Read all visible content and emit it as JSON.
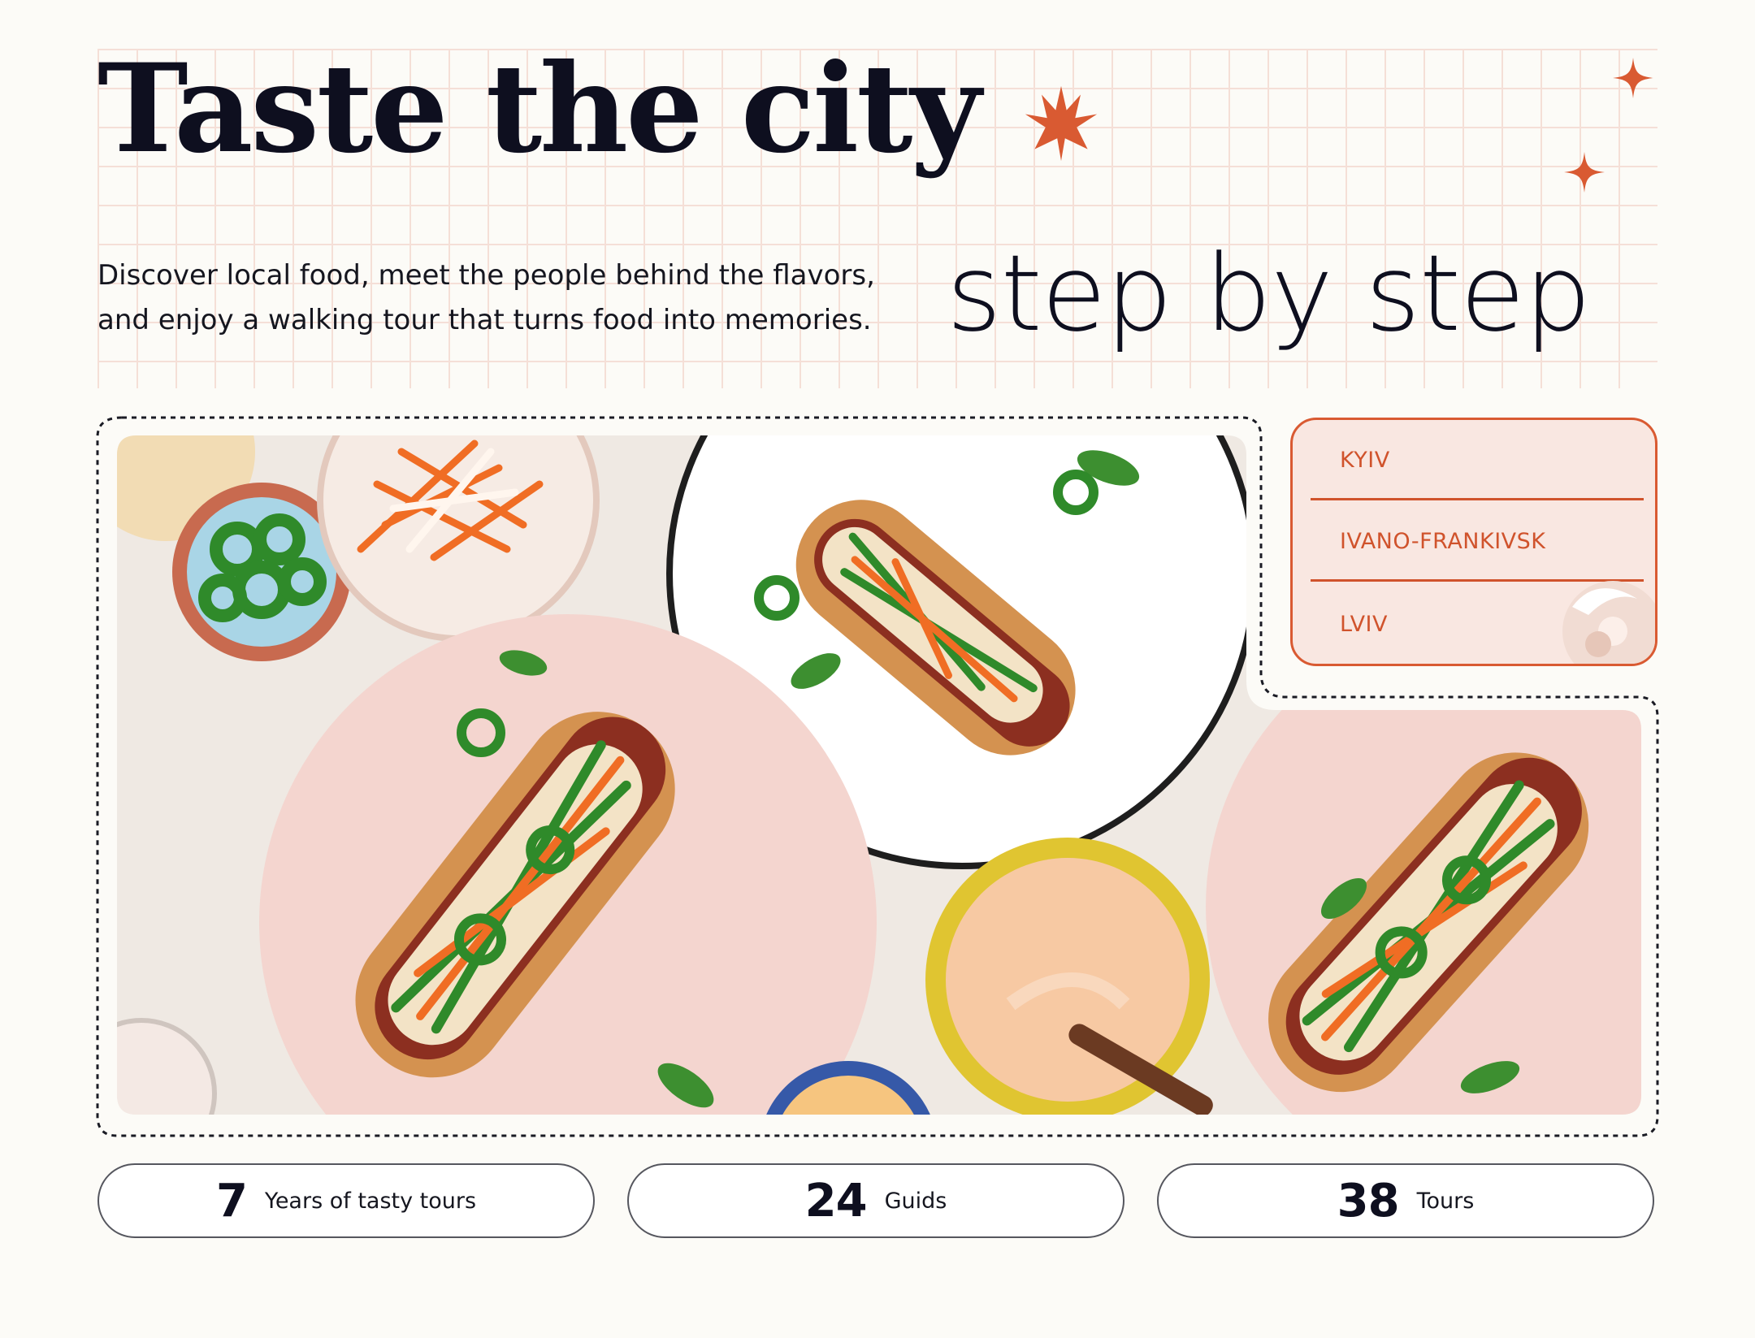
{
  "hero": {
    "title": "Taste the city",
    "tagline": "step by step",
    "description": "Discover local food, meet the people behind the flavors, and enjoy a walking tour that turns food into memories."
  },
  "cities": [
    "KYIV",
    "IVANO-FRANKIVSK",
    "LVIV"
  ],
  "stats": [
    {
      "value": "7",
      "label": "Years of tasty tours"
    },
    {
      "value": "24",
      "label": "Guids"
    },
    {
      "value": "38",
      "label": "Tours"
    }
  ],
  "colors": {
    "accent": "#d95a32",
    "background": "#fcfbf7",
    "card_background": "#f9e7e1",
    "text": "#0e0f1f"
  },
  "icons": [
    "starburst-icon",
    "sparkle-icon",
    "donut-icon"
  ]
}
